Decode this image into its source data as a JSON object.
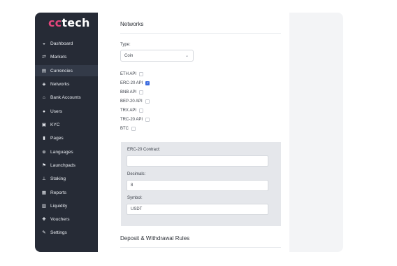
{
  "brand": {
    "mark": "cc",
    "word": "tech"
  },
  "sidebar": {
    "items": [
      {
        "label": "Dashboard",
        "icon": "dashboard-icon",
        "glyph": "◒"
      },
      {
        "label": "Markets",
        "icon": "swap-arrows-icon",
        "glyph": "⇄"
      },
      {
        "label": "Currencies",
        "icon": "money-icon",
        "glyph": "▤",
        "active": true
      },
      {
        "label": "Networks",
        "icon": "layers-icon",
        "glyph": "◈"
      },
      {
        "label": "Bank Accounts",
        "icon": "bank-icon",
        "glyph": "⌂"
      },
      {
        "label": "Users",
        "icon": "user-icon",
        "glyph": "●"
      },
      {
        "label": "KYC",
        "icon": "id-card-icon",
        "glyph": "▣"
      },
      {
        "label": "Pages",
        "icon": "file-icon",
        "glyph": "▮"
      },
      {
        "label": "Languages",
        "icon": "globe-icon",
        "glyph": "⊕"
      },
      {
        "label": "Launchpads",
        "icon": "flag-icon",
        "glyph": "⚑"
      },
      {
        "label": "Staking",
        "icon": "staking-icon",
        "glyph": "⊥"
      },
      {
        "label": "Reports",
        "icon": "report-icon",
        "glyph": "▦"
      },
      {
        "label": "Liquidity",
        "icon": "liquidity-icon",
        "glyph": "▥"
      },
      {
        "label": "Vouchers",
        "icon": "gift-icon",
        "glyph": "✚"
      },
      {
        "label": "Settings",
        "icon": "wrench-icon",
        "glyph": "✎"
      }
    ]
  },
  "networks": {
    "title": "Networks",
    "type_label": "Type:",
    "type_value": "Coin",
    "apis": [
      {
        "label": "ETH API",
        "checked": false
      },
      {
        "label": "ERC-20 API",
        "checked": true
      },
      {
        "label": "BNB API",
        "checked": false
      },
      {
        "label": "BEP-20 API",
        "checked": false
      },
      {
        "label": "TRX API",
        "checked": false
      },
      {
        "label": "TRC-20 API",
        "checked": false
      },
      {
        "label": "BTC",
        "checked": false
      }
    ]
  },
  "erc20": {
    "contract_label": "ERC-20 Contract:",
    "contract_value": "",
    "decimals_label": "Decimals:",
    "decimals_value": "8",
    "symbol_label": "Symbol:",
    "symbol_value": "USDT"
  },
  "rules": {
    "title": "Deposit & Withdrawal Rules"
  },
  "colors": {
    "sidebar": "#262b36",
    "accent": "#e3467c",
    "checkbox": "#3b6be0"
  }
}
